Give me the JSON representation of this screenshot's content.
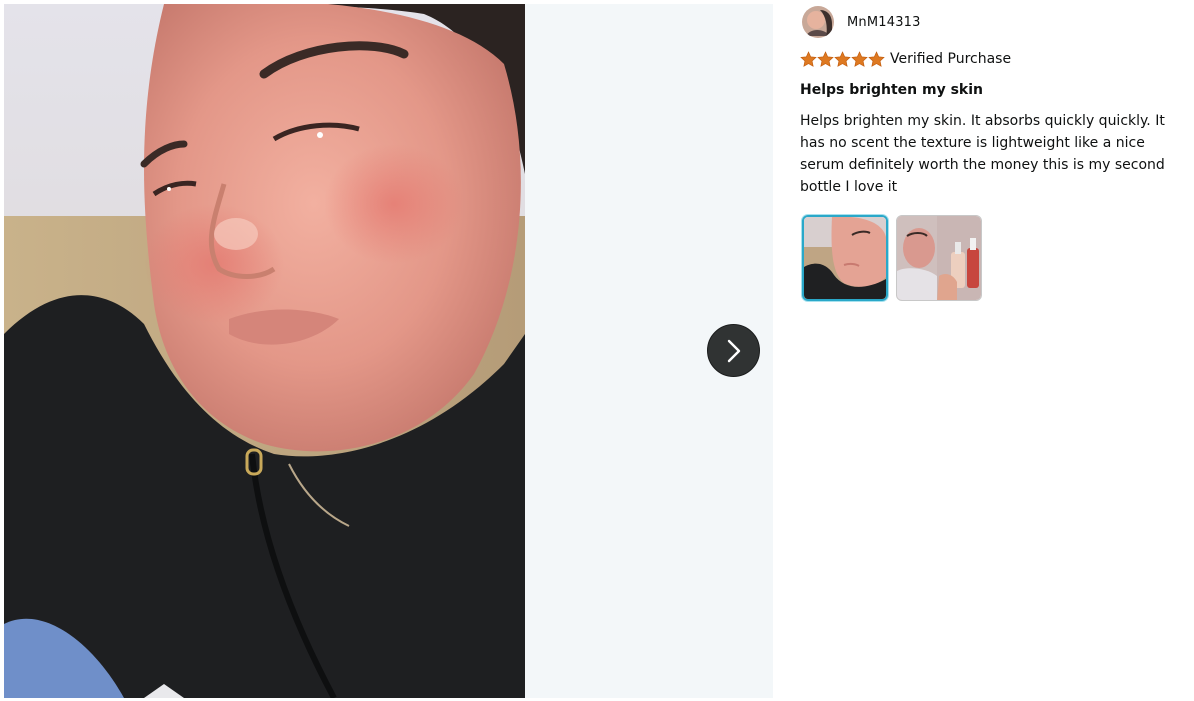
{
  "review": {
    "reviewer_name": "MnM14313",
    "rating": 5,
    "rating_max": 5,
    "verified_label": "Verified Purchase",
    "title": "Helps brighten my skin",
    "body": "Helps brighten my skin. It absorbs quickly quickly. It has no scent the texture is lightweight like a nice serum definitely worth the money this is my second bottle I love it"
  },
  "gallery": {
    "selected_index": 0,
    "thumbnails": [
      {
        "icon": "selfie-photo-thumbnail"
      },
      {
        "icon": "product-photo-thumbnail"
      }
    ],
    "next_icon": "chevron-right-icon"
  },
  "colors": {
    "star": "#de7921",
    "selected_thumb_border": "#2aa8c9",
    "viewer_background": "#f3f7f9",
    "next_button": "#303333"
  }
}
